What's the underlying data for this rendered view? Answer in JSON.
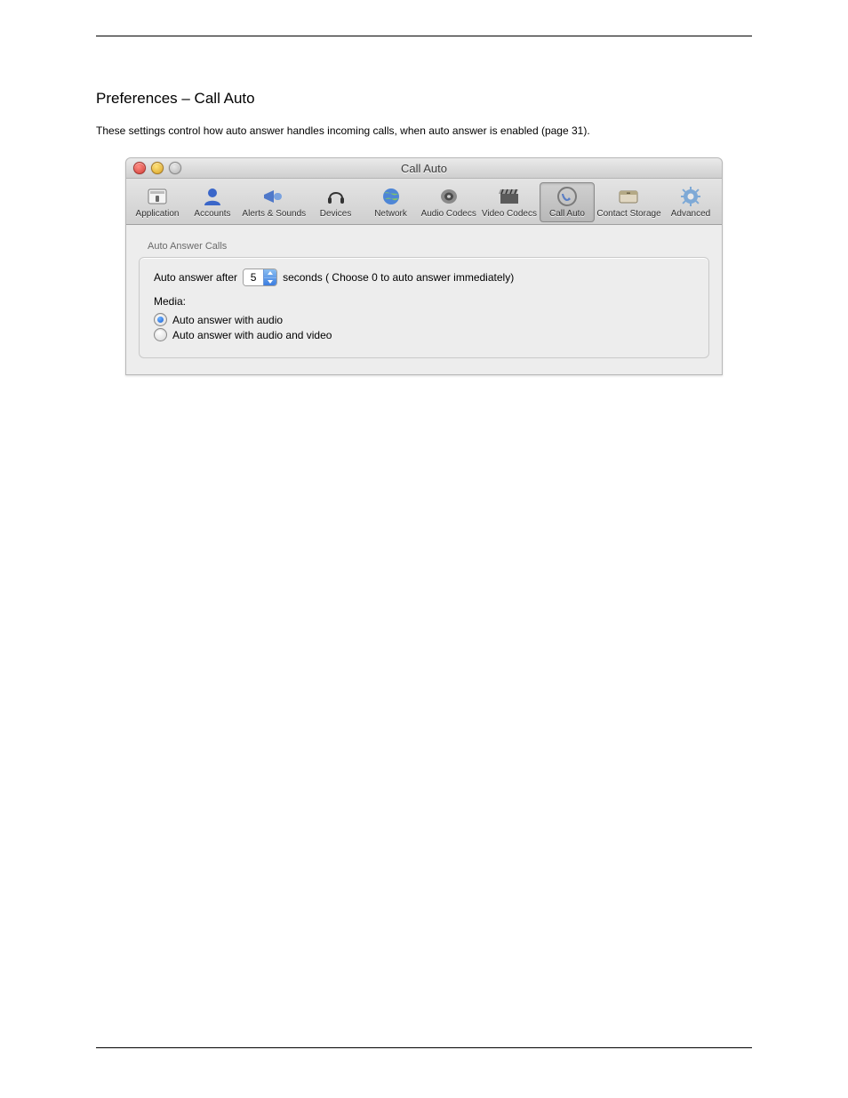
{
  "section_title": "Preferences – Call Auto",
  "intro": "These settings control how auto answer handles incoming calls, when auto answer is enabled (page 31).",
  "window": {
    "title": "Call Auto",
    "toolbar": [
      {
        "label": "Application",
        "icon": "application"
      },
      {
        "label": "Accounts",
        "icon": "accounts"
      },
      {
        "label": "Alerts & Sounds",
        "icon": "alerts"
      },
      {
        "label": "Devices",
        "icon": "devices"
      },
      {
        "label": "Network",
        "icon": "network"
      },
      {
        "label": "Audio Codecs",
        "icon": "audio-codecs"
      },
      {
        "label": "Video Codecs",
        "icon": "video-codecs"
      },
      {
        "label": "Call Auto",
        "icon": "call-auto",
        "selected": true
      },
      {
        "label": "Contact Storage",
        "icon": "contact-storage"
      },
      {
        "label": "Advanced",
        "icon": "advanced"
      }
    ],
    "group_title": "Auto Answer Calls",
    "auto_answer": {
      "prefix": "Auto answer after",
      "value": "5",
      "suffix": "seconds ( Choose 0 to auto answer immediately)"
    },
    "media_label": "Media:",
    "radios": [
      {
        "label": "Auto answer with audio",
        "selected": true
      },
      {
        "label": "Auto answer with audio and video",
        "selected": false
      }
    ]
  }
}
